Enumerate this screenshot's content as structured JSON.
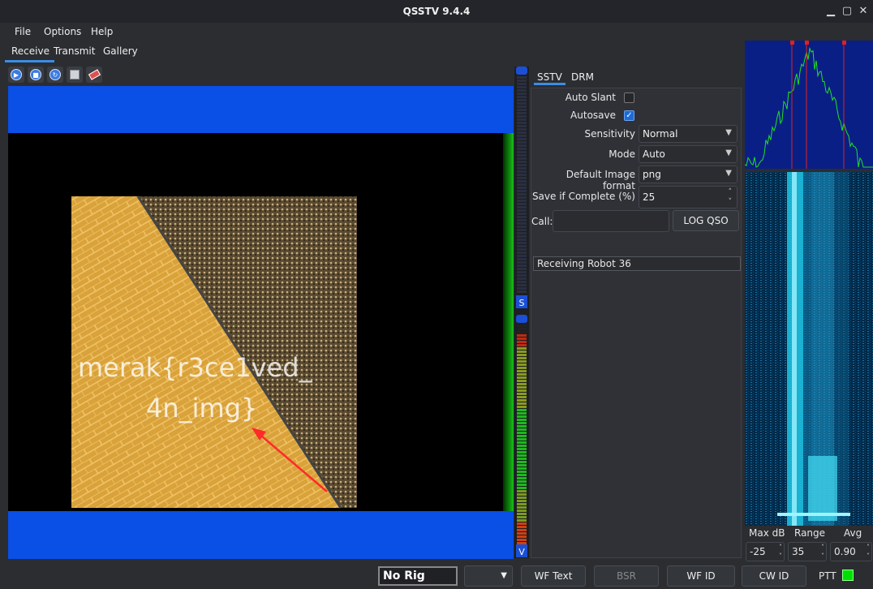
{
  "window": {
    "title": "QSSTV 9.4.4"
  },
  "menu": [
    "File",
    "Options",
    "Help"
  ],
  "tabs": [
    "Receive",
    "Transmit",
    "Gallery"
  ],
  "image": {
    "overlay_line1": "merak{r3ce1ved_",
    "overlay_line2": "4n_img}"
  },
  "sstv_tabs": [
    "SSTV",
    "DRM"
  ],
  "form": {
    "auto_slant_label": "Auto Slant",
    "autosave_label": "Autosave",
    "autosave_checked": true,
    "sensitivity_label": "Sensitivity",
    "sensitivity_value": "Normal",
    "mode_label": "Mode",
    "mode_value": "Auto",
    "image_format_label": "Default Image format",
    "image_format_value": "png",
    "save_complete_label": "Save if Complete (%)",
    "save_complete_value": "25",
    "call_label": "Call:",
    "call_value": "",
    "log_qso_label": "LOG QSO",
    "status_text": "Receiving Robot 36"
  },
  "meter": {
    "top_label": "S",
    "bottom_label": "V"
  },
  "waterfall": {
    "maxdb_label": "Max dB",
    "maxdb_value": "-25",
    "range_label": "Range",
    "range_value": "35",
    "avg_label": "Avg",
    "avg_value": "0.90"
  },
  "bottom": {
    "rig": "No Rig",
    "wf_text": "WF Text",
    "bsr": "BSR",
    "wf_id": "WF ID",
    "cw_id": "CW ID",
    "ptt": "PTT"
  },
  "colors": {
    "accent": "#3a8ee6",
    "image_blue": "#0a4fe6",
    "ptt": "#00e000"
  }
}
